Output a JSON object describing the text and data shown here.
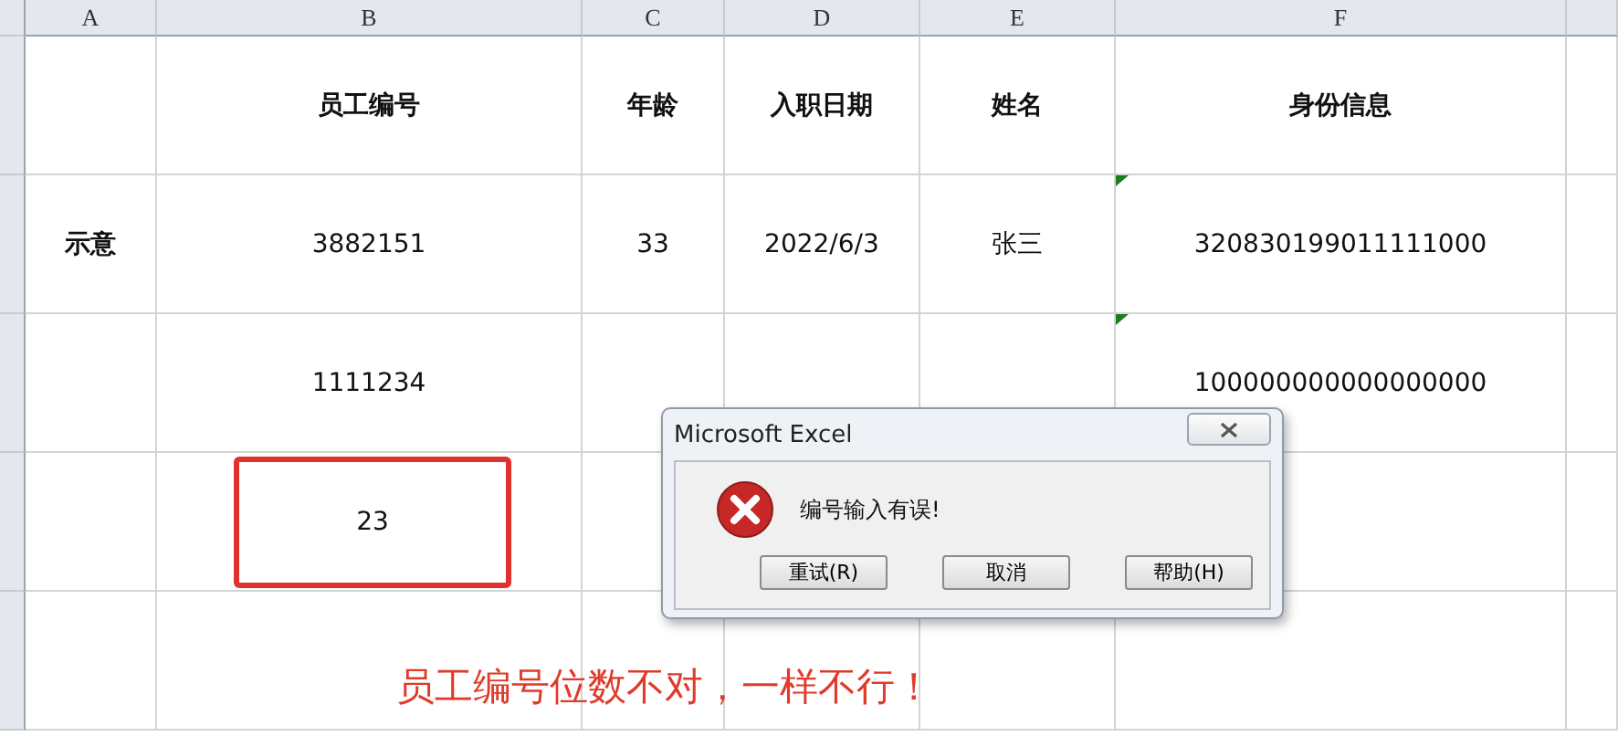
{
  "columns": [
    "A",
    "B",
    "C",
    "D",
    "E",
    "F"
  ],
  "rows": [
    {
      "header": true,
      "cells": [
        null,
        "员工编号",
        "年龄",
        "入职日期",
        "姓名",
        "身份信息"
      ],
      "flagged": false,
      "highlighted": false
    },
    {
      "header": false,
      "cells": [
        "示意",
        "3882151",
        "33",
        "2022/6/3",
        "张三",
        "320830199011111000"
      ],
      "flagged": true,
      "highlighted": false
    },
    {
      "header": false,
      "cells": [
        null,
        "1111234",
        null,
        null,
        null,
        "100000000000000000"
      ],
      "flagged": true,
      "highlighted": false
    },
    {
      "header": false,
      "cells": [
        null,
        "23",
        null,
        null,
        null,
        null
      ],
      "flagged": false,
      "highlighted": true
    }
  ],
  "dialog": {
    "title": "Microsoft Excel",
    "message": "编号输入有误!",
    "buttons": [
      "重试(R)",
      "取消",
      "帮助(H)"
    ]
  },
  "annotation": "员工编号位数不对，一样不行！"
}
